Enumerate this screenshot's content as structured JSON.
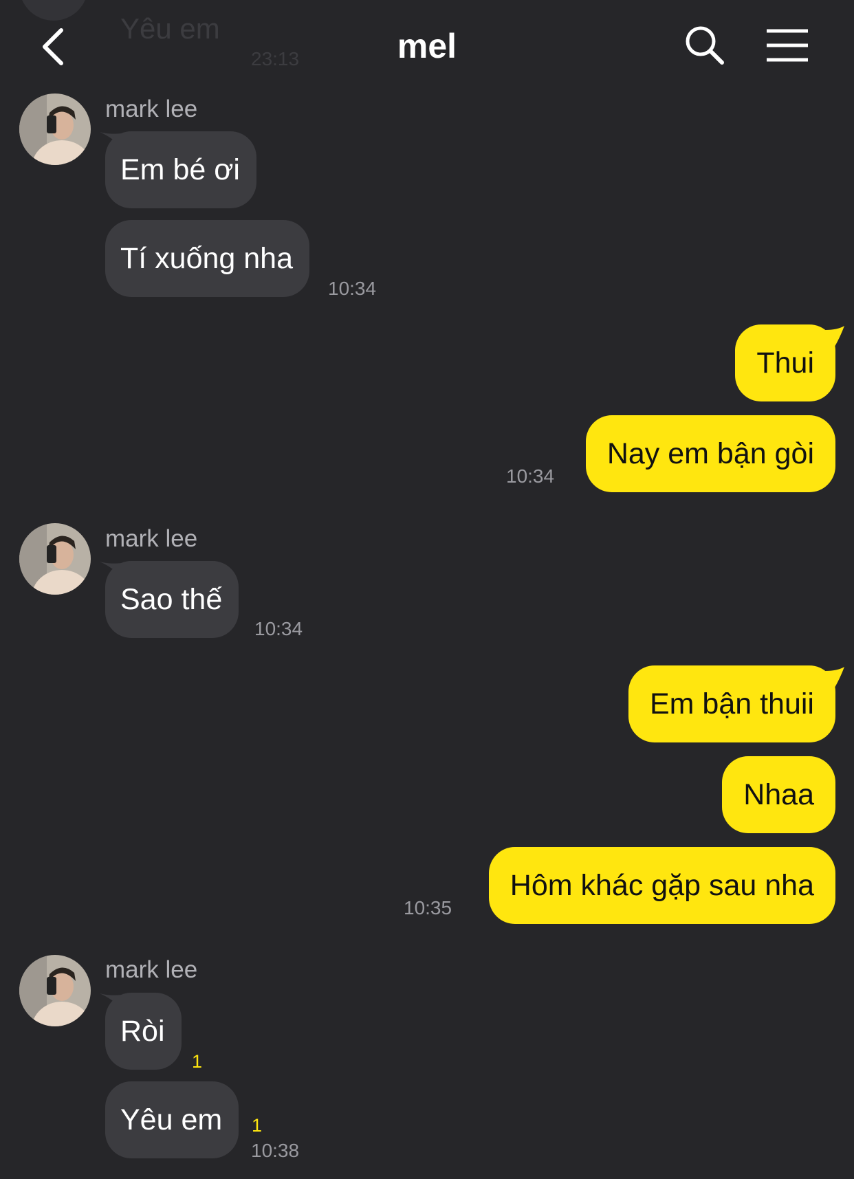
{
  "header": {
    "title": "mel"
  },
  "previous": {
    "message": "Yêu em",
    "time": "23:13"
  },
  "colors": {
    "background": "#262629",
    "incoming_bubble": "#3c3c40",
    "outgoing_bubble": "#ffe60f",
    "unread_count": "#ffe60f"
  },
  "icons": {
    "back": "chevron-left-icon",
    "search": "search-icon",
    "menu": "hamburger-menu-icon"
  },
  "groups": [
    {
      "sender": "mark lee",
      "messages": [
        "Em bé ơi",
        "Tí xuống nha"
      ],
      "time": "10:34"
    },
    {
      "messages": [
        "Thui",
        "Nay em bận gòi"
      ],
      "time": "10:34"
    },
    {
      "sender": "mark lee",
      "messages": [
        "Sao thế"
      ],
      "time": "10:34"
    },
    {
      "messages": [
        "Em bận thuii",
        "Nhaa",
        "Hôm khác gặp sau nha"
      ],
      "time": "10:35"
    },
    {
      "sender": "mark lee",
      "messages": [
        "Ròi",
        "Yêu em"
      ],
      "unread": [
        "1",
        "1"
      ],
      "time": "10:38"
    }
  ]
}
